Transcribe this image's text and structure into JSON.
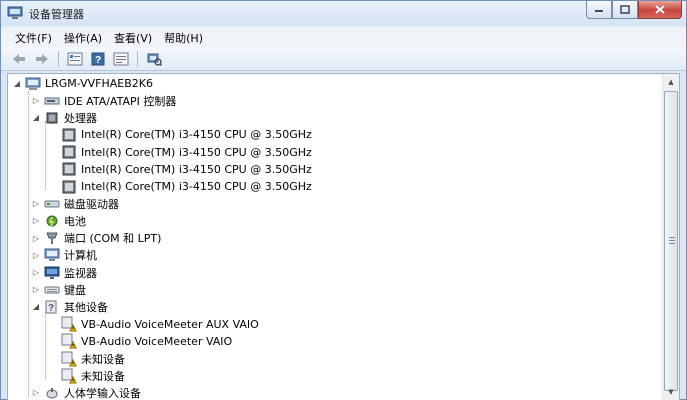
{
  "window": {
    "title": "设备管理器"
  },
  "menu": [
    "文件(F)",
    "操作(A)",
    "查看(V)",
    "帮助(H)"
  ],
  "toolbar": {
    "icons": [
      "back-icon",
      "forward-icon",
      "properties-icon",
      "help-icon",
      "show-hidden-icon",
      "scan-hardware-icon"
    ]
  },
  "tree": {
    "root": "LRGM-VVFHAEB2K6",
    "items": [
      {
        "label": "IDE ATA/ATAPI 控制器",
        "icon": "ide-controller-icon",
        "level": 1,
        "expanded": false
      },
      {
        "label": "处理器",
        "icon": "processor-icon",
        "level": 1,
        "expanded": true
      },
      {
        "label": "Intel(R) Core(TM) i3-4150 CPU @ 3.50GHz",
        "icon": "cpu-icon",
        "level": 2
      },
      {
        "label": "Intel(R) Core(TM) i3-4150 CPU @ 3.50GHz",
        "icon": "cpu-icon",
        "level": 2
      },
      {
        "label": "Intel(R) Core(TM) i3-4150 CPU @ 3.50GHz",
        "icon": "cpu-icon",
        "level": 2
      },
      {
        "label": "Intel(R) Core(TM) i3-4150 CPU @ 3.50GHz",
        "icon": "cpu-icon",
        "level": 2
      },
      {
        "label": "磁盘驱动器",
        "icon": "disk-drive-icon",
        "level": 1,
        "expanded": false
      },
      {
        "label": "电池",
        "icon": "battery-icon",
        "level": 1,
        "expanded": false
      },
      {
        "label": "端口 (COM 和 LPT)",
        "icon": "port-icon",
        "level": 1,
        "expanded": false
      },
      {
        "label": "计算机",
        "icon": "computer-icon",
        "level": 1,
        "expanded": false
      },
      {
        "label": "监视器",
        "icon": "monitor-icon",
        "level": 1,
        "expanded": false
      },
      {
        "label": "键盘",
        "icon": "keyboard-icon",
        "level": 1,
        "expanded": false
      },
      {
        "label": "其他设备",
        "icon": "other-devices-icon",
        "level": 1,
        "expanded": true
      },
      {
        "label": "VB-Audio VoiceMeeter AUX VAIO",
        "icon": "warning-device-icon",
        "level": 2
      },
      {
        "label": "VB-Audio VoiceMeeter VAIO",
        "icon": "warning-device-icon",
        "level": 2
      },
      {
        "label": "未知设备",
        "icon": "warning-device-icon",
        "level": 2
      },
      {
        "label": "未知设备",
        "icon": "warning-device-icon",
        "level": 2
      },
      {
        "label": "人体学输入设备",
        "icon": "hid-icon",
        "level": 1,
        "expanded": false
      }
    ]
  },
  "colors": {
    "titlebar": "#dbe7f4",
    "close": "#c7443a",
    "warning": "#f2c200"
  }
}
